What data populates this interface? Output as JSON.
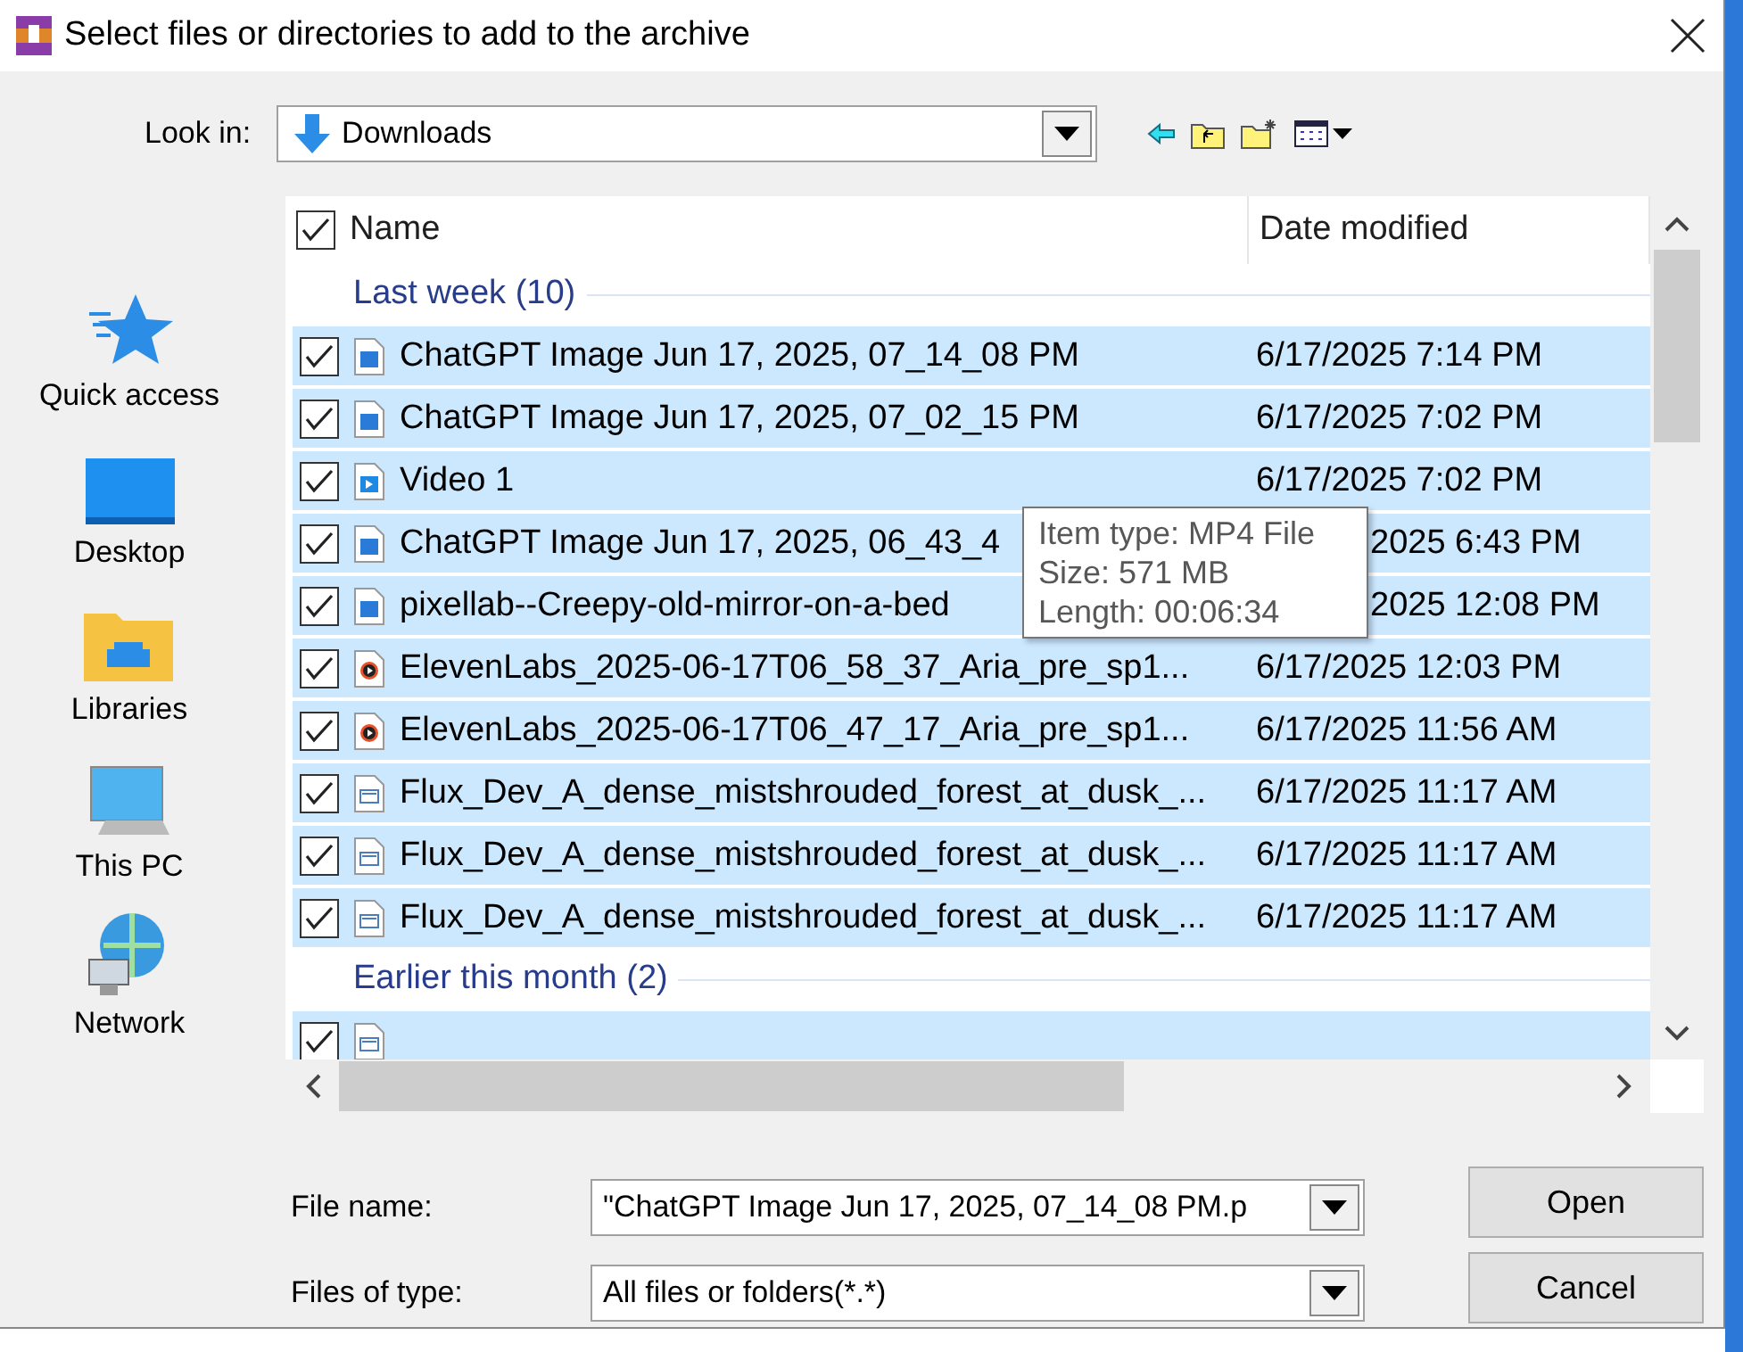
{
  "window": {
    "title": "Select files or directories to add to the archive"
  },
  "look_in": {
    "label": "Look in:",
    "value": "Downloads"
  },
  "places": [
    {
      "label": "Quick access",
      "kind": "star"
    },
    {
      "label": "Desktop",
      "kind": "desktop"
    },
    {
      "label": "Libraries",
      "kind": "libraries"
    },
    {
      "label": "This PC",
      "kind": "pc"
    },
    {
      "label": "Network",
      "kind": "network"
    }
  ],
  "table": {
    "select_all": {
      "checked": true
    },
    "columns": [
      "Name",
      "Date modified"
    ],
    "groups": [
      {
        "label": "Last week (10)",
        "rows": [
          {
            "name": "ChatGPT Image Jun 17, 2025, 07_14_08 PM",
            "date": "6/17/2025 7:14 PM",
            "kind": "image",
            "checked": true,
            "under_tooltip": false
          },
          {
            "name": "ChatGPT Image Jun 17, 2025, 07_02_15 PM",
            "date": "6/17/2025 7:02 PM",
            "kind": "image",
            "checked": true,
            "under_tooltip": false
          },
          {
            "name": "Video 1",
            "date": "6/17/2025 7:02 PM",
            "kind": "video",
            "checked": true,
            "under_tooltip": false
          },
          {
            "name": "ChatGPT Image Jun 17, 2025, 06_43_4",
            "date": "2025 6:43 PM",
            "kind": "image",
            "checked": true,
            "under_tooltip": true
          },
          {
            "name": "pixellab--Creepy-old-mirror-on-a-bed",
            "date": "2025 12:08 PM",
            "kind": "image",
            "checked": true,
            "under_tooltip": true
          },
          {
            "name": "ElevenLabs_2025-06-17T06_58_37_Aria_pre_sp1...",
            "date": "6/17/2025 12:03 PM",
            "kind": "audio",
            "checked": true,
            "under_tooltip": false
          },
          {
            "name": "ElevenLabs_2025-06-17T06_47_17_Aria_pre_sp1...",
            "date": "6/17/2025 11:56 AM",
            "kind": "audio",
            "checked": true,
            "under_tooltip": false
          },
          {
            "name": "Flux_Dev_A_dense_mistshrouded_forest_at_dusk_...",
            "date": "6/17/2025 11:17 AM",
            "kind": "doc",
            "checked": true,
            "under_tooltip": false
          },
          {
            "name": "Flux_Dev_A_dense_mistshrouded_forest_at_dusk_...",
            "date": "6/17/2025 11:17 AM",
            "kind": "doc",
            "checked": true,
            "under_tooltip": false
          },
          {
            "name": "Flux_Dev_A_dense_mistshrouded_forest_at_dusk_...",
            "date": "6/17/2025 11:17 AM",
            "kind": "doc",
            "checked": true,
            "under_tooltip": false
          }
        ]
      },
      {
        "label": "Earlier this month (2)",
        "rows": [
          {
            "kind": "doc",
            "checked": true
          }
        ]
      }
    ]
  },
  "tooltip": [
    "Item type: MP4 File",
    "Size: 571 MB",
    "Length: 00:06:34"
  ],
  "file_name": {
    "label": "File name:",
    "value": "\"ChatGPT Image Jun 17, 2025, 07_14_08 PM.p"
  },
  "file_type": {
    "label": "Files of type:",
    "value": "All files or folders(*.*)"
  },
  "buttons": [
    "Open",
    "Cancel"
  ]
}
